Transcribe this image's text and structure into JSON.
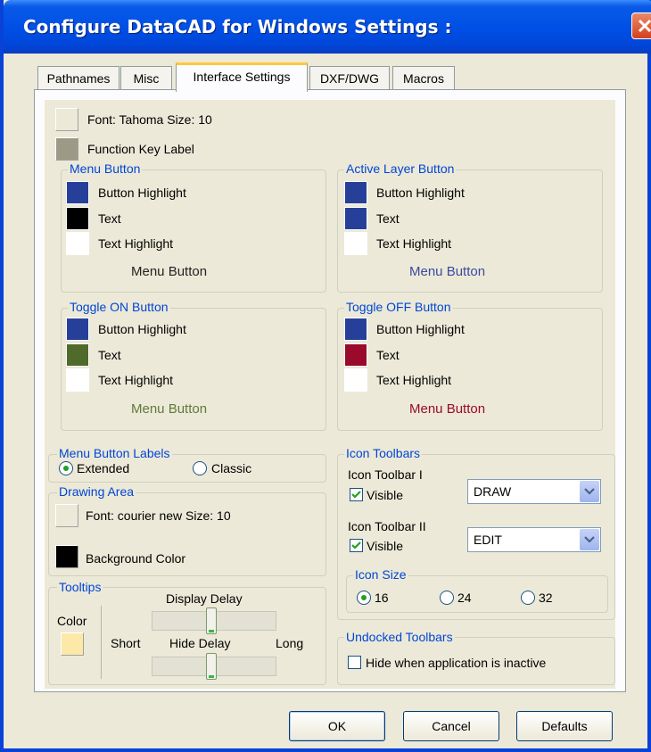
{
  "window": {
    "title": "Configure DataCAD for Windows Settings :"
  },
  "tabs": [
    {
      "label": "Pathnames"
    },
    {
      "label": "Misc"
    },
    {
      "label": "Interface Settings"
    },
    {
      "label": "DXF/DWG"
    },
    {
      "label": "Macros"
    }
  ],
  "font": {
    "label": "Font: Tahoma  Size: 10"
  },
  "function_key": {
    "label": "Function Key Label"
  },
  "menu_button": {
    "title": "Menu Button",
    "highlight": "Button Highlight",
    "text": "Text",
    "text_highlight": "Text Highlight",
    "sample": "Menu Button",
    "colors": {
      "highlight": "#26409a",
      "text": "#000000",
      "text_highlight": "#ffffff",
      "sample": "#222222"
    }
  },
  "active_layer": {
    "title": "Active Layer Button",
    "highlight": "Button Highlight",
    "text": "Text",
    "text_highlight": "Text Highlight",
    "sample": "Menu Button",
    "colors": {
      "highlight": "#26409a",
      "text": "#26409a",
      "text_highlight": "#ffffff",
      "sample": "#3b4aa0"
    }
  },
  "toggle_on": {
    "title": "Toggle ON Button",
    "highlight": "Button Highlight",
    "text": "Text",
    "text_highlight": "Text Highlight",
    "sample": "Menu Button",
    "colors": {
      "highlight": "#26409a",
      "text": "#4f6a2a",
      "text_highlight": "#ffffff",
      "sample": "#5f7a3a"
    }
  },
  "toggle_off": {
    "title": "Toggle OFF Button",
    "highlight": "Button Highlight",
    "text": "Text",
    "text_highlight": "Text Highlight",
    "sample": "Menu Button",
    "colors": {
      "highlight": "#26409a",
      "text": "#9a0a2a",
      "text_highlight": "#ffffff",
      "sample": "#9a0a2a"
    }
  },
  "menu_labels": {
    "title": "Menu Button Labels",
    "extended": "Extended",
    "classic": "Classic",
    "selected": "Extended"
  },
  "drawing_area": {
    "title": "Drawing Area",
    "font": "Font: courier new  Size: 10",
    "background": "Background Color"
  },
  "tooltips": {
    "title": "Tooltips",
    "color": "Color",
    "display_delay": "Display Delay",
    "hide_delay": "Hide Delay",
    "short": "Short",
    "long": "Long",
    "display_delay_level": 0.48,
    "hide_delay_level": 0.48,
    "swatch_color": "#fce9a8"
  },
  "icon_toolbars": {
    "title": "Icon Toolbars",
    "toolbar1": {
      "label": "Icon Toolbar I",
      "visible": "Visible",
      "checked": true,
      "value": "DRAW"
    },
    "toolbar2": {
      "label": "Icon Toolbar II",
      "visible": "Visible",
      "checked": true,
      "value": "EDIT"
    },
    "icon_size": {
      "title": "Icon Size",
      "options": [
        "16",
        "24",
        "32"
      ],
      "selected": "16"
    }
  },
  "undocked": {
    "title": "Undocked Toolbars",
    "hide": "Hide when application is inactive",
    "checked": false
  },
  "buttons": {
    "ok": "OK",
    "cancel": "Cancel",
    "defaults": "Defaults"
  }
}
